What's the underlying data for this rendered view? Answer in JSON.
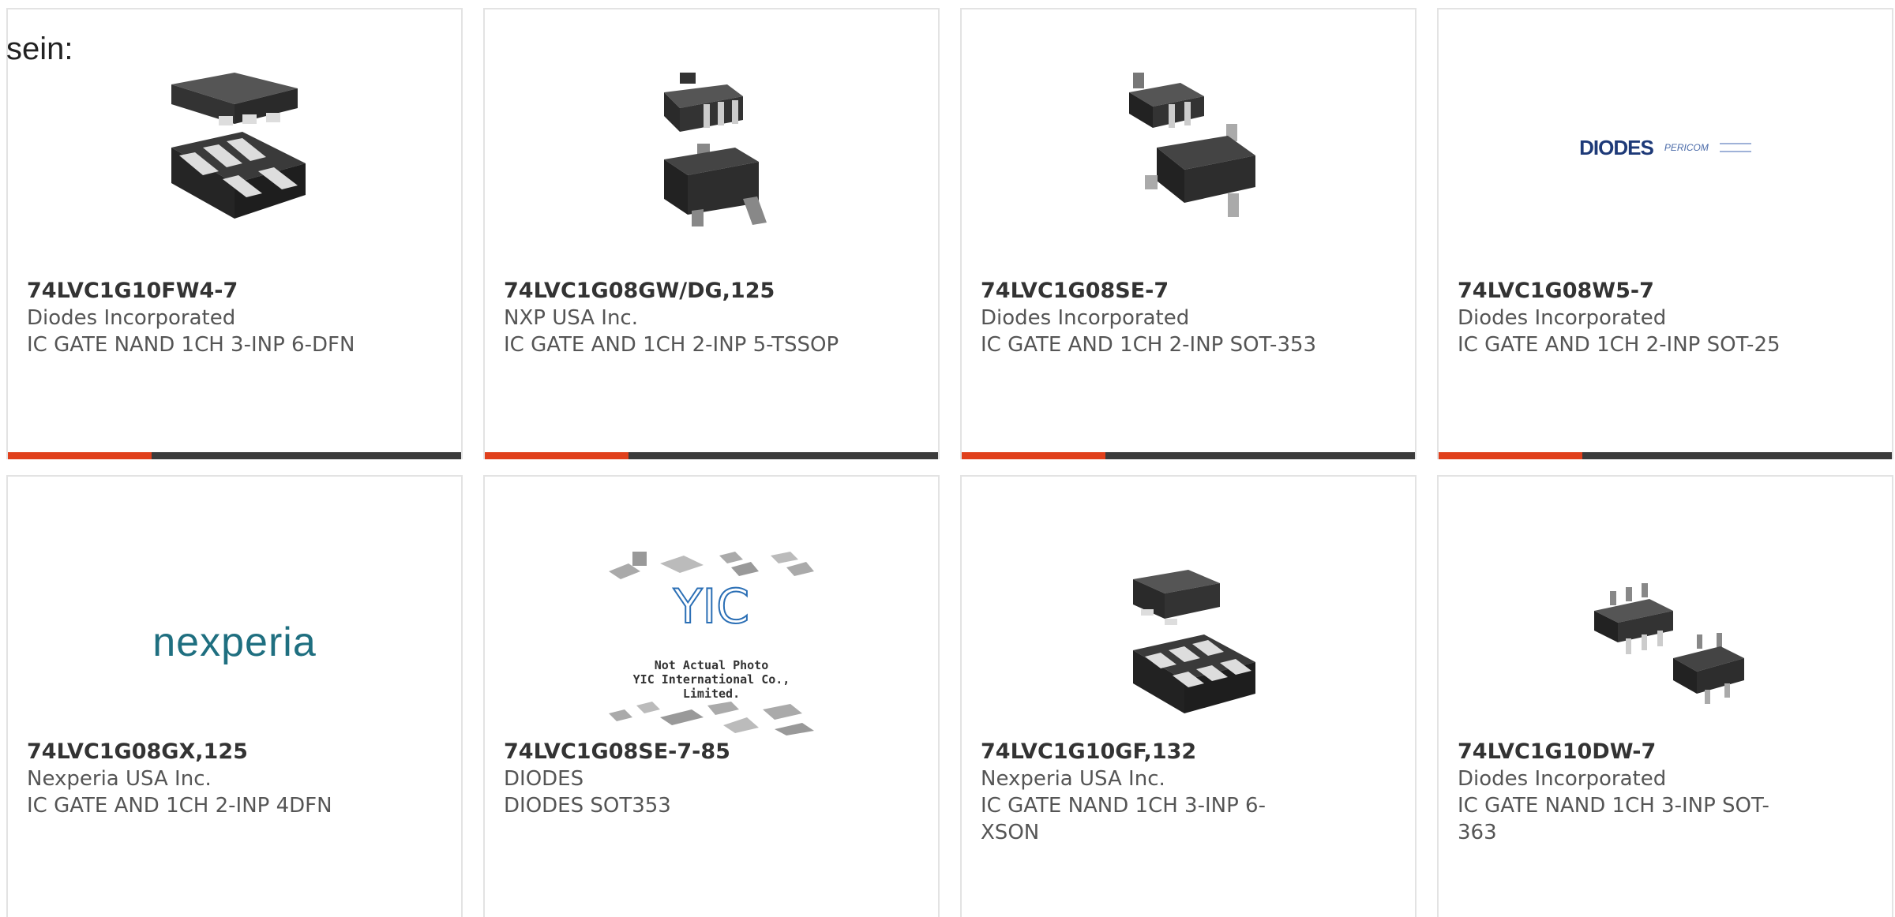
{
  "intro_text": "sein:",
  "colors": {
    "accent": "#e0401c",
    "bar": "#3b3b3b",
    "border": "#e3e3e3"
  },
  "products": [
    {
      "part": "74LVC1G10FW4-7",
      "maker": "Diodes Incorporated",
      "description": "IC GATE NAND 1CH 3-INP 6-DFN",
      "image": "dfn-6-package-icon"
    },
    {
      "part": "74LVC1G08GW/DG,125",
      "maker": "NXP USA Inc.",
      "description": "IC GATE AND 1CH 2-INP 5-TSSOP",
      "image": "tssop-5-package-icon"
    },
    {
      "part": "74LVC1G08SE-7",
      "maker": "Diodes Incorporated",
      "description": "IC GATE AND 1CH 2-INP SOT-353",
      "image": "sot-353-package-icon"
    },
    {
      "part": "74LVC1G08W5-7",
      "maker": "Diodes Incorporated",
      "description": "IC GATE AND 1CH 2-INP SOT-25",
      "image": "diodes-pericom-logo",
      "logo_text": "DIODES",
      "logo_sub": "PERICOM"
    },
    {
      "part": "74LVC1G08GX,125",
      "maker": "Nexperia USA Inc.",
      "description": "IC GATE AND 1CH 2-INP 4DFN",
      "image": "nexperia-logo",
      "logo_text": "nexperia"
    },
    {
      "part": "74LVC1G08SE-7-85",
      "maker": "DIODES",
      "description": "DIODES SOT353",
      "image": "not-actual-photo-placeholder",
      "placeholder_line1": "Not Actual Photo",
      "placeholder_line2": "YIC International Co., Limited."
    },
    {
      "part": "74LVC1G10GF,132",
      "maker": "Nexperia USA Inc.",
      "description": "IC GATE NAND 1CH 3-INP 6-XSON",
      "image": "xson-6-package-icon"
    },
    {
      "part": "74LVC1G10DW-7",
      "maker": "Diodes Incorporated",
      "description": "IC GATE NAND 1CH 3-INP SOT-363",
      "image": "sot-363-package-icon"
    }
  ]
}
